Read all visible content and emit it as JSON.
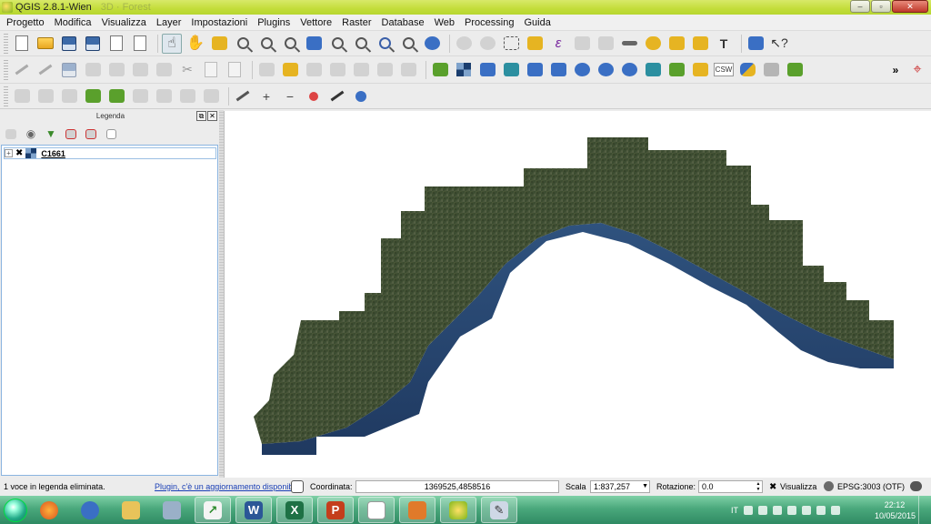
{
  "window": {
    "title": "QGIS 2.8.1-Wien",
    "ghost_title": "3D · Forest"
  },
  "menubar": {
    "items": [
      "Progetto",
      "Modifica",
      "Visualizza",
      "Layer",
      "Impostazioni",
      "Plugins",
      "Vettore",
      "Raster",
      "Database",
      "Web",
      "Processing",
      "Guida"
    ]
  },
  "toolbars": {
    "row1": [
      "new-project",
      "open-project",
      "save-project",
      "save-as",
      "new-print-composer",
      "composer-manager",
      "touch-zoom-pan",
      "pan-map",
      "pan-to-selection",
      "zoom-in",
      "zoom-out",
      "zoom-native",
      "zoom-full",
      "zoom-to-selection",
      "zoom-to-layer",
      "zoom-last",
      "zoom-next",
      "refresh",
      "identify",
      "action",
      "select-features",
      "deselect",
      "field-calculator",
      "open-attribute-table",
      "statistics",
      "measure",
      "map-tips",
      "new-bookmark",
      "show-bookmarks",
      "text-annotation",
      "help-contents",
      "whats-this"
    ],
    "row2": [
      "current-edits",
      "toggle-editing",
      "save-edits",
      "add-feature",
      "move-feature",
      "node-tool",
      "delete-selected",
      "cut-features",
      "copy-features",
      "paste-features",
      "label-1",
      "label-2",
      "label-3",
      "label-4",
      "label-5",
      "label-6",
      "label-7",
      "add-vector-layer",
      "add-raster-layer",
      "add-postgis-layer",
      "add-spatialite-layer",
      "add-mssql-layer",
      "add-oracle-layer",
      "add-wms-layer",
      "add-wcs-layer",
      "add-wfs-layer",
      "add-delimited-text",
      "new-layer",
      "add-csw",
      "python-console",
      "plugin-b",
      "plugin-c",
      "more",
      "crosshair"
    ],
    "row3": [
      "adv-1",
      "adv-2",
      "adv-3",
      "adv-4",
      "adv-5",
      "adv-6",
      "adv-7",
      "adv-8",
      "adv-9",
      "digitize-1",
      "digitize-2",
      "digitize-3",
      "digitize-4",
      "digitize-5",
      "digitize-6"
    ]
  },
  "legend": {
    "title": "Legenda",
    "layer_name": "C1661"
  },
  "statusbar": {
    "message": "1 voce in legenda eliminata.",
    "plugin_link": "Plugin, c'è un aggiornamento disponibile",
    "coord_label": "Coordinata:",
    "coord_value": "1369525,4858516",
    "scale_label": "Scala",
    "scale_value": "1:837,257",
    "rotation_label": "Rotazione:",
    "rotation_value": "0.0",
    "render_label": "Visualizza",
    "crs": "EPSG:3003 (OTF)"
  },
  "taskbar": {
    "apps": [
      "firefox",
      "outlook",
      "explorer",
      "calculator",
      "chart",
      "word",
      "excel",
      "powerpoint",
      "notepad",
      "media",
      "qgis",
      "paint"
    ],
    "language": "IT",
    "time": "22:12",
    "date": "10/05/2015"
  },
  "colors": {
    "title_accent": "#c3dd3a",
    "taskbar": "#4aa87c",
    "map_land": "#3d4a30",
    "map_sea": "#2e4f7a",
    "link": "#1a3fb5"
  }
}
